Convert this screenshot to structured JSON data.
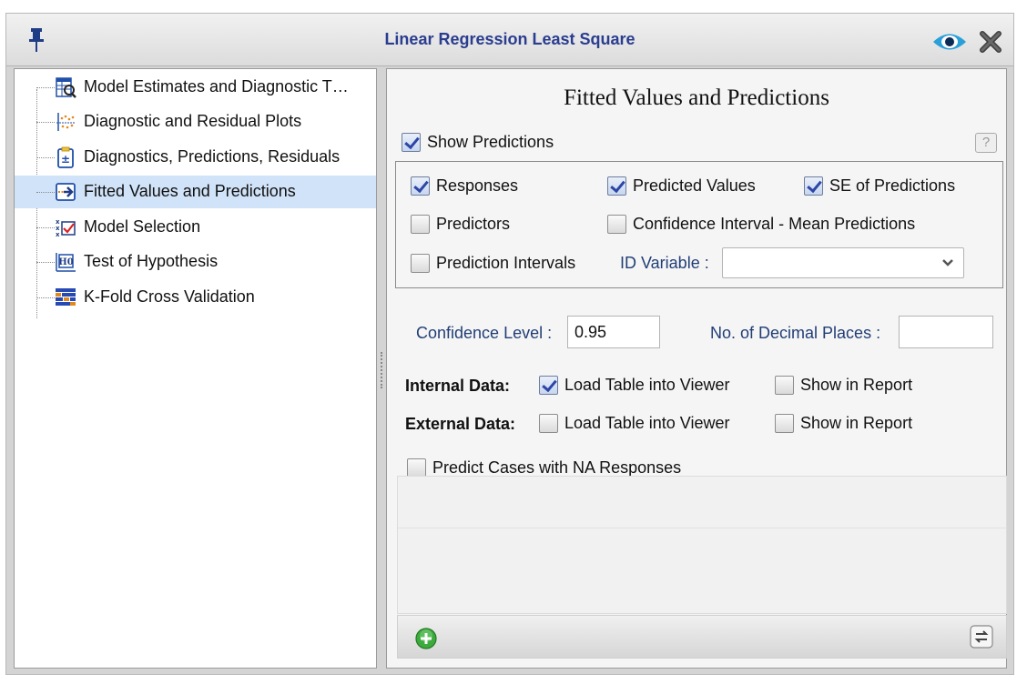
{
  "window": {
    "title": "Linear Regression Least Square"
  },
  "tree": {
    "items": [
      {
        "label": "Model Estimates and Diagnostic T…",
        "icon": "table-search-icon"
      },
      {
        "label": "Diagnostic and Residual Plots",
        "icon": "scatter-plot-icon"
      },
      {
        "label": "Diagnostics, Predictions, Residuals",
        "icon": "clipboard-plus-minus-icon"
      },
      {
        "label": "Fitted Values and Predictions",
        "icon": "arrow-right-box-icon"
      },
      {
        "label": "Model Selection",
        "icon": "checklist-icon"
      },
      {
        "label": "Test of Hypothesis",
        "icon": "hypothesis-icon"
      },
      {
        "label": "K-Fold Cross Validation",
        "icon": "grid-blocks-icon"
      }
    ],
    "selected_index": 3
  },
  "panel": {
    "title": "Fitted Values and Predictions",
    "show_predictions": {
      "label": "Show Predictions",
      "checked": true
    },
    "help": "?",
    "options": {
      "responses": {
        "label": "Responses",
        "checked": true
      },
      "predicted_values": {
        "label": "Predicted Values",
        "checked": true
      },
      "se_predictions": {
        "label": "SE of Predictions",
        "checked": true
      },
      "predictors": {
        "label": "Predictors",
        "checked": false
      },
      "ci_mean": {
        "label": "Confidence Interval - Mean Predictions",
        "checked": false
      },
      "prediction_intervals": {
        "label": "Prediction Intervals",
        "checked": false
      },
      "id_variable_label": "ID Variable :",
      "id_variable_value": ""
    },
    "confidence_level": {
      "label": "Confidence Level :",
      "value": "0.95"
    },
    "decimal_places": {
      "label": "No. of Decimal Places :",
      "value": ""
    },
    "internal_data": {
      "label": "Internal Data:",
      "load_table": {
        "label": "Load Table into Viewer",
        "checked": true
      },
      "show_report": {
        "label": "Show in Report",
        "checked": false
      }
    },
    "external_data": {
      "label": "External Data:",
      "load_table": {
        "label": "Load Table into Viewer",
        "checked": false
      },
      "show_report": {
        "label": "Show in Report",
        "checked": false
      }
    },
    "predict_na": {
      "label": "Predict Cases with NA Responses",
      "checked": false
    }
  },
  "colors": {
    "title_blue": "#2a3d8f",
    "selected_row": "#d1e3f8",
    "label_blue": "#213e76"
  }
}
